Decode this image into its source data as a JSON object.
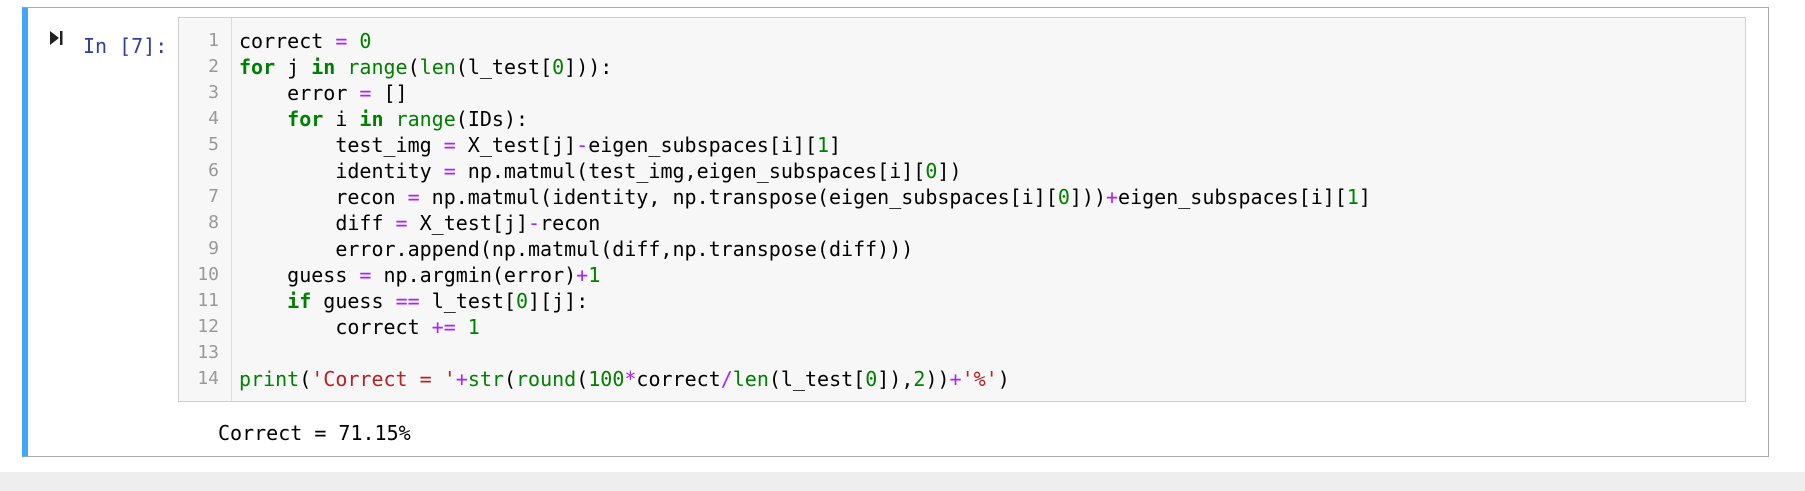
{
  "cell": {
    "prompt": "In [7]:",
    "run_icon": "run-cell-icon",
    "accent_color": "#42a5f5",
    "output": "Correct = 71.15%"
  },
  "code_lines": [
    {
      "num": "1",
      "tokens": [
        [
          "tx",
          "correct "
        ],
        [
          "op",
          "="
        ],
        [
          "tx",
          " "
        ],
        [
          "num",
          "0"
        ]
      ]
    },
    {
      "num": "2",
      "tokens": [
        [
          "kw",
          "for"
        ],
        [
          "tx",
          " j "
        ],
        [
          "kw",
          "in"
        ],
        [
          "tx",
          " "
        ],
        [
          "bi",
          "range"
        ],
        [
          "tx",
          "("
        ],
        [
          "bi",
          "len"
        ],
        [
          "tx",
          "(l_test["
        ],
        [
          "num",
          "0"
        ],
        [
          "tx",
          "])):"
        ]
      ]
    },
    {
      "num": "3",
      "tokens": [
        [
          "tx",
          "    error "
        ],
        [
          "op",
          "="
        ],
        [
          "tx",
          " []"
        ]
      ]
    },
    {
      "num": "4",
      "tokens": [
        [
          "tx",
          "    "
        ],
        [
          "kw",
          "for"
        ],
        [
          "tx",
          " i "
        ],
        [
          "kw",
          "in"
        ],
        [
          "tx",
          " "
        ],
        [
          "bi",
          "range"
        ],
        [
          "tx",
          "(IDs):"
        ]
      ]
    },
    {
      "num": "5",
      "tokens": [
        [
          "tx",
          "        test_img "
        ],
        [
          "op",
          "="
        ],
        [
          "tx",
          " X_test[j]"
        ],
        [
          "op",
          "-"
        ],
        [
          "tx",
          "eigen_subspaces[i]["
        ],
        [
          "num",
          "1"
        ],
        [
          "tx",
          "]"
        ]
      ]
    },
    {
      "num": "6",
      "tokens": [
        [
          "tx",
          "        identity "
        ],
        [
          "op",
          "="
        ],
        [
          "tx",
          " np.matmul(test_img,eigen_subspaces[i]["
        ],
        [
          "num",
          "0"
        ],
        [
          "tx",
          "])"
        ]
      ]
    },
    {
      "num": "7",
      "tokens": [
        [
          "tx",
          "        recon "
        ],
        [
          "op",
          "="
        ],
        [
          "tx",
          " np.matmul(identity, np.transpose(eigen_subspaces[i]["
        ],
        [
          "num",
          "0"
        ],
        [
          "tx",
          "]))"
        ],
        [
          "op",
          "+"
        ],
        [
          "tx",
          "eigen_subspaces[i]["
        ],
        [
          "num",
          "1"
        ],
        [
          "tx",
          "]"
        ]
      ]
    },
    {
      "num": "8",
      "tokens": [
        [
          "tx",
          "        diff "
        ],
        [
          "op",
          "="
        ],
        [
          "tx",
          " X_test[j]"
        ],
        [
          "op",
          "-"
        ],
        [
          "tx",
          "recon"
        ]
      ]
    },
    {
      "num": "9",
      "tokens": [
        [
          "tx",
          "        error.append(np.matmul(diff,np.transpose(diff)))"
        ]
      ]
    },
    {
      "num": "10",
      "tokens": [
        [
          "tx",
          "    guess "
        ],
        [
          "op",
          "="
        ],
        [
          "tx",
          " np.argmin(error)"
        ],
        [
          "op",
          "+"
        ],
        [
          "num",
          "1"
        ]
      ]
    },
    {
      "num": "11",
      "tokens": [
        [
          "tx",
          "    "
        ],
        [
          "kw",
          "if"
        ],
        [
          "tx",
          " guess "
        ],
        [
          "op",
          "=="
        ],
        [
          "tx",
          " l_test["
        ],
        [
          "num",
          "0"
        ],
        [
          "tx",
          "][j]:"
        ]
      ]
    },
    {
      "num": "12",
      "tokens": [
        [
          "tx",
          "        correct "
        ],
        [
          "op",
          "+="
        ],
        [
          "tx",
          " "
        ],
        [
          "num",
          "1"
        ]
      ]
    },
    {
      "num": "13",
      "tokens": []
    },
    {
      "num": "14",
      "tokens": [
        [
          "bi",
          "print"
        ],
        [
          "tx",
          "("
        ],
        [
          "str",
          "'Correct = '"
        ],
        [
          "op",
          "+"
        ],
        [
          "bi",
          "str"
        ],
        [
          "tx",
          "("
        ],
        [
          "bi",
          "round"
        ],
        [
          "tx",
          "("
        ],
        [
          "num",
          "100"
        ],
        [
          "op",
          "*"
        ],
        [
          "tx",
          "correct"
        ],
        [
          "op",
          "/"
        ],
        [
          "bi",
          "len"
        ],
        [
          "tx",
          "(l_test["
        ],
        [
          "num",
          "0"
        ],
        [
          "tx",
          "]),"
        ],
        [
          "num",
          "2"
        ],
        [
          "tx",
          "))"
        ],
        [
          "op",
          "+"
        ],
        [
          "str",
          "'%'"
        ],
        [
          "tx",
          ")"
        ]
      ]
    }
  ]
}
